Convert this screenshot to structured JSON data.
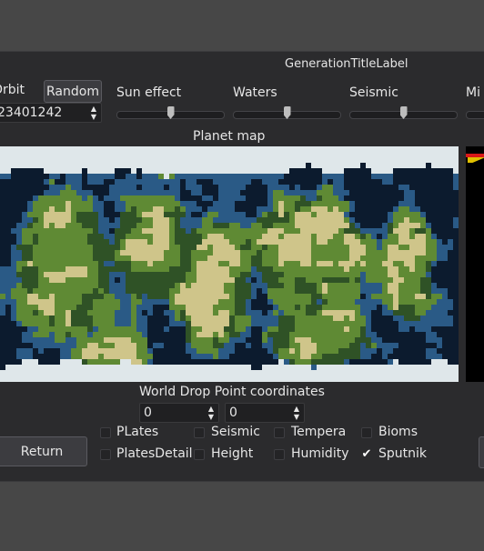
{
  "header": {
    "title": "GenerationTitleLabel"
  },
  "orbit": {
    "label": "Orbit",
    "value": "23401242",
    "random_label": "Random"
  },
  "sliders": [
    {
      "label": "Sun effect",
      "level": 0.5
    },
    {
      "label": "Waters",
      "level": 0.5
    },
    {
      "label": "Seismic",
      "level": 0.5
    },
    {
      "label": "Mi",
      "level": 0.0
    }
  ],
  "map": {
    "title": "Planet map"
  },
  "drop_point": {
    "title": "World Drop Point coordinates",
    "x_value": "0",
    "y_value": "0"
  },
  "buttons": {
    "return_label": "Return"
  },
  "checkboxes": [
    {
      "label": "PLates",
      "checked": false
    },
    {
      "label": "Seismic",
      "checked": false
    },
    {
      "label": "Tempera",
      "checked": false
    },
    {
      "label": "Bioms",
      "checked": false
    },
    {
      "label": "PlatesDetail",
      "checked": false
    },
    {
      "label": "Height",
      "checked": false
    },
    {
      "label": "Humidity",
      "checked": false
    },
    {
      "label": "Sputnik",
      "checked": true
    }
  ],
  "colors": {
    "ocean_deep": "#0c1b2e",
    "ocean_shallow": "#2a5a86",
    "forest": "#2f5226",
    "grass": "#5f8a34",
    "sand": "#cfc58a",
    "ice": "#dfe7ea"
  }
}
